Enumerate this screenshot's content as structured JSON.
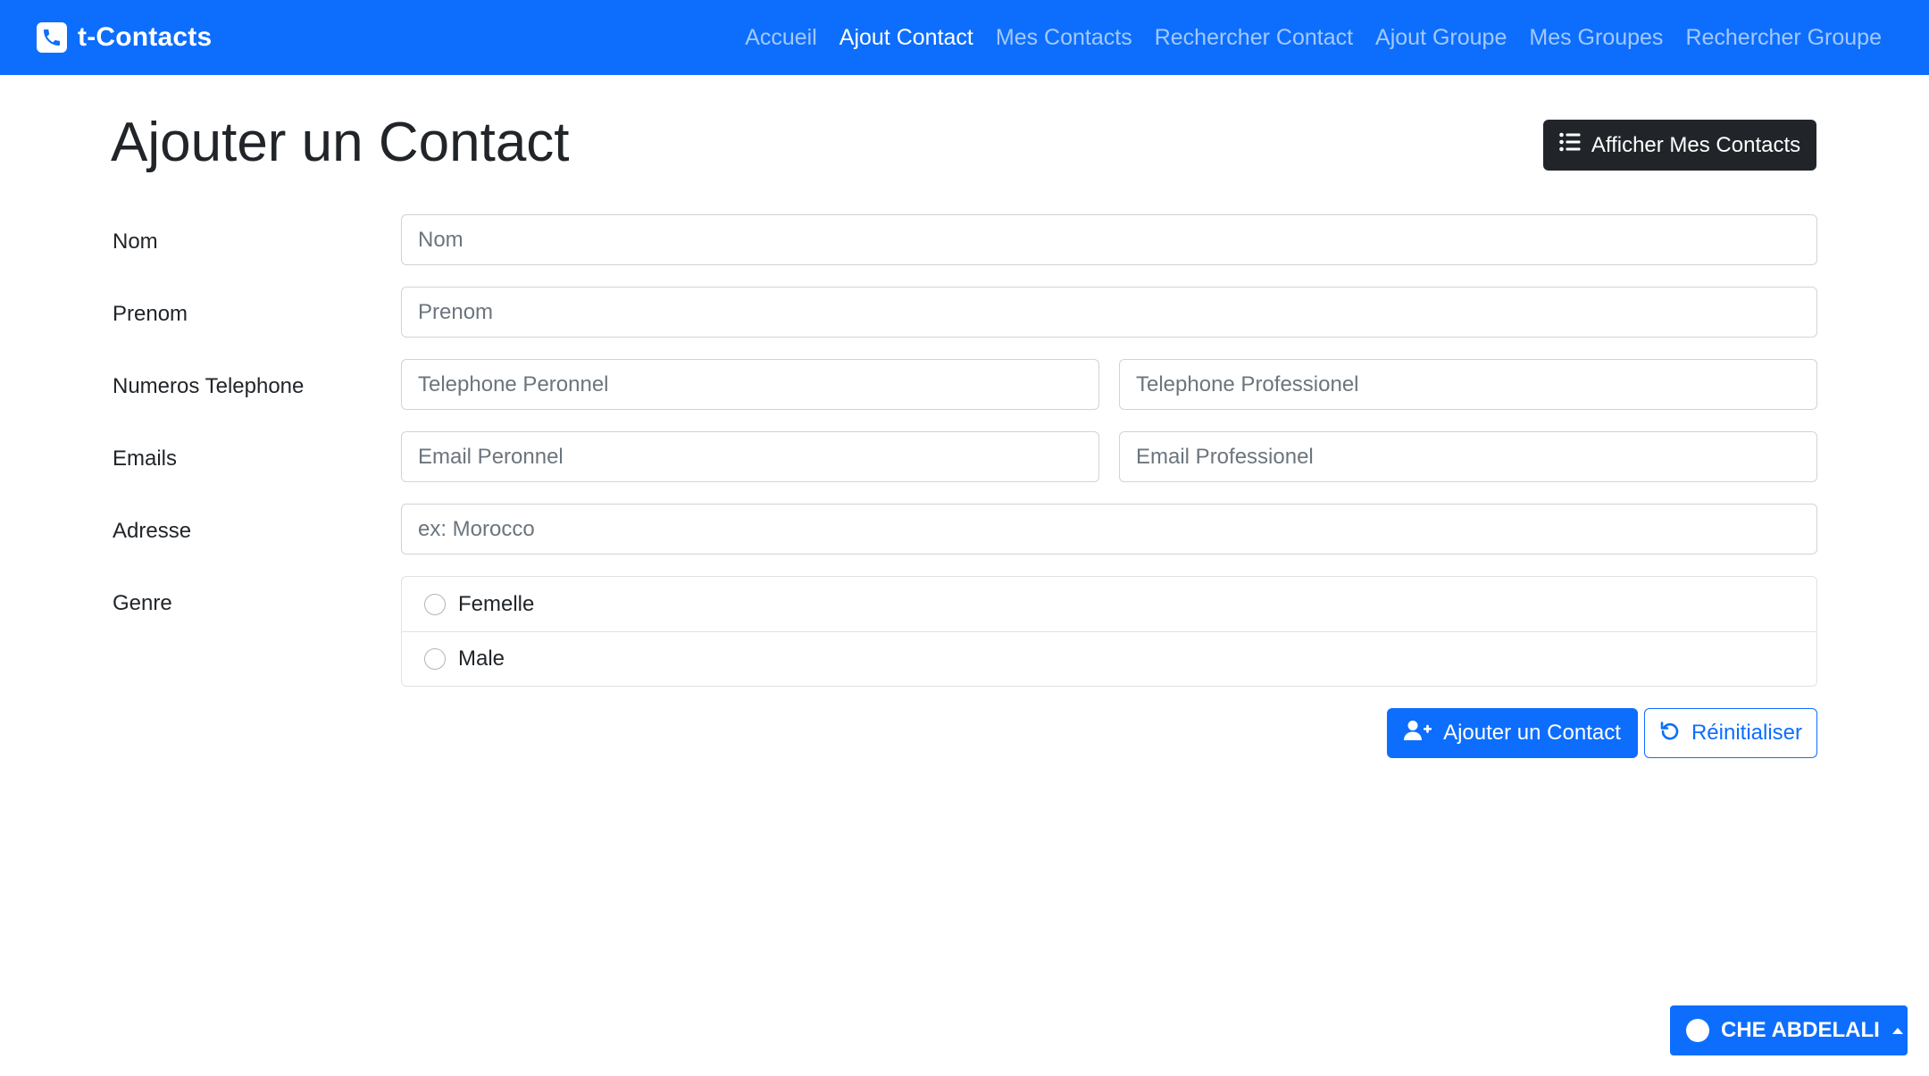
{
  "app": {
    "brand": "t-Contacts",
    "brand_icon": "phone-icon"
  },
  "nav": {
    "items": [
      {
        "label": "Accueil",
        "active": false
      },
      {
        "label": "Ajout Contact",
        "active": true
      },
      {
        "label": "Mes Contacts",
        "active": false
      },
      {
        "label": "Rechercher Contact",
        "active": false
      },
      {
        "label": "Ajout Groupe",
        "active": false
      },
      {
        "label": "Mes Groupes",
        "active": false
      },
      {
        "label": "Rechercher Groupe",
        "active": false
      }
    ]
  },
  "header": {
    "title": "Ajouter un Contact",
    "show_contacts_button": "Afficher Mes Contacts",
    "show_contacts_icon": "list-icon"
  },
  "form": {
    "nom": {
      "label": "Nom",
      "placeholder": "Nom",
      "value": ""
    },
    "prenom": {
      "label": "Prenom",
      "placeholder": "Prenom",
      "value": ""
    },
    "telephone": {
      "label": "Numeros Telephone",
      "personnel_placeholder": "Telephone Peronnel",
      "professionel_placeholder": "Telephone Professionel"
    },
    "emails": {
      "label": "Emails",
      "personnel_placeholder": "Email Peronnel",
      "professionel_placeholder": "Email Professionel"
    },
    "adresse": {
      "label": "Adresse",
      "placeholder": "ex: Morocco",
      "value": ""
    },
    "genre": {
      "label": "Genre",
      "options": [
        {
          "label": "Femelle",
          "checked": false
        },
        {
          "label": "Male",
          "checked": false
        }
      ]
    },
    "submit_label": "Ajouter un Contact",
    "submit_icon": "user-plus-icon",
    "reset_label": "Réinitialiser",
    "reset_icon": "undo-icon"
  },
  "user": {
    "name": "CHE ABDELALI"
  },
  "colors": {
    "primary": "#0d6efd",
    "dark": "#212529",
    "border": "#ced4da",
    "placeholder": "#6c757d"
  }
}
